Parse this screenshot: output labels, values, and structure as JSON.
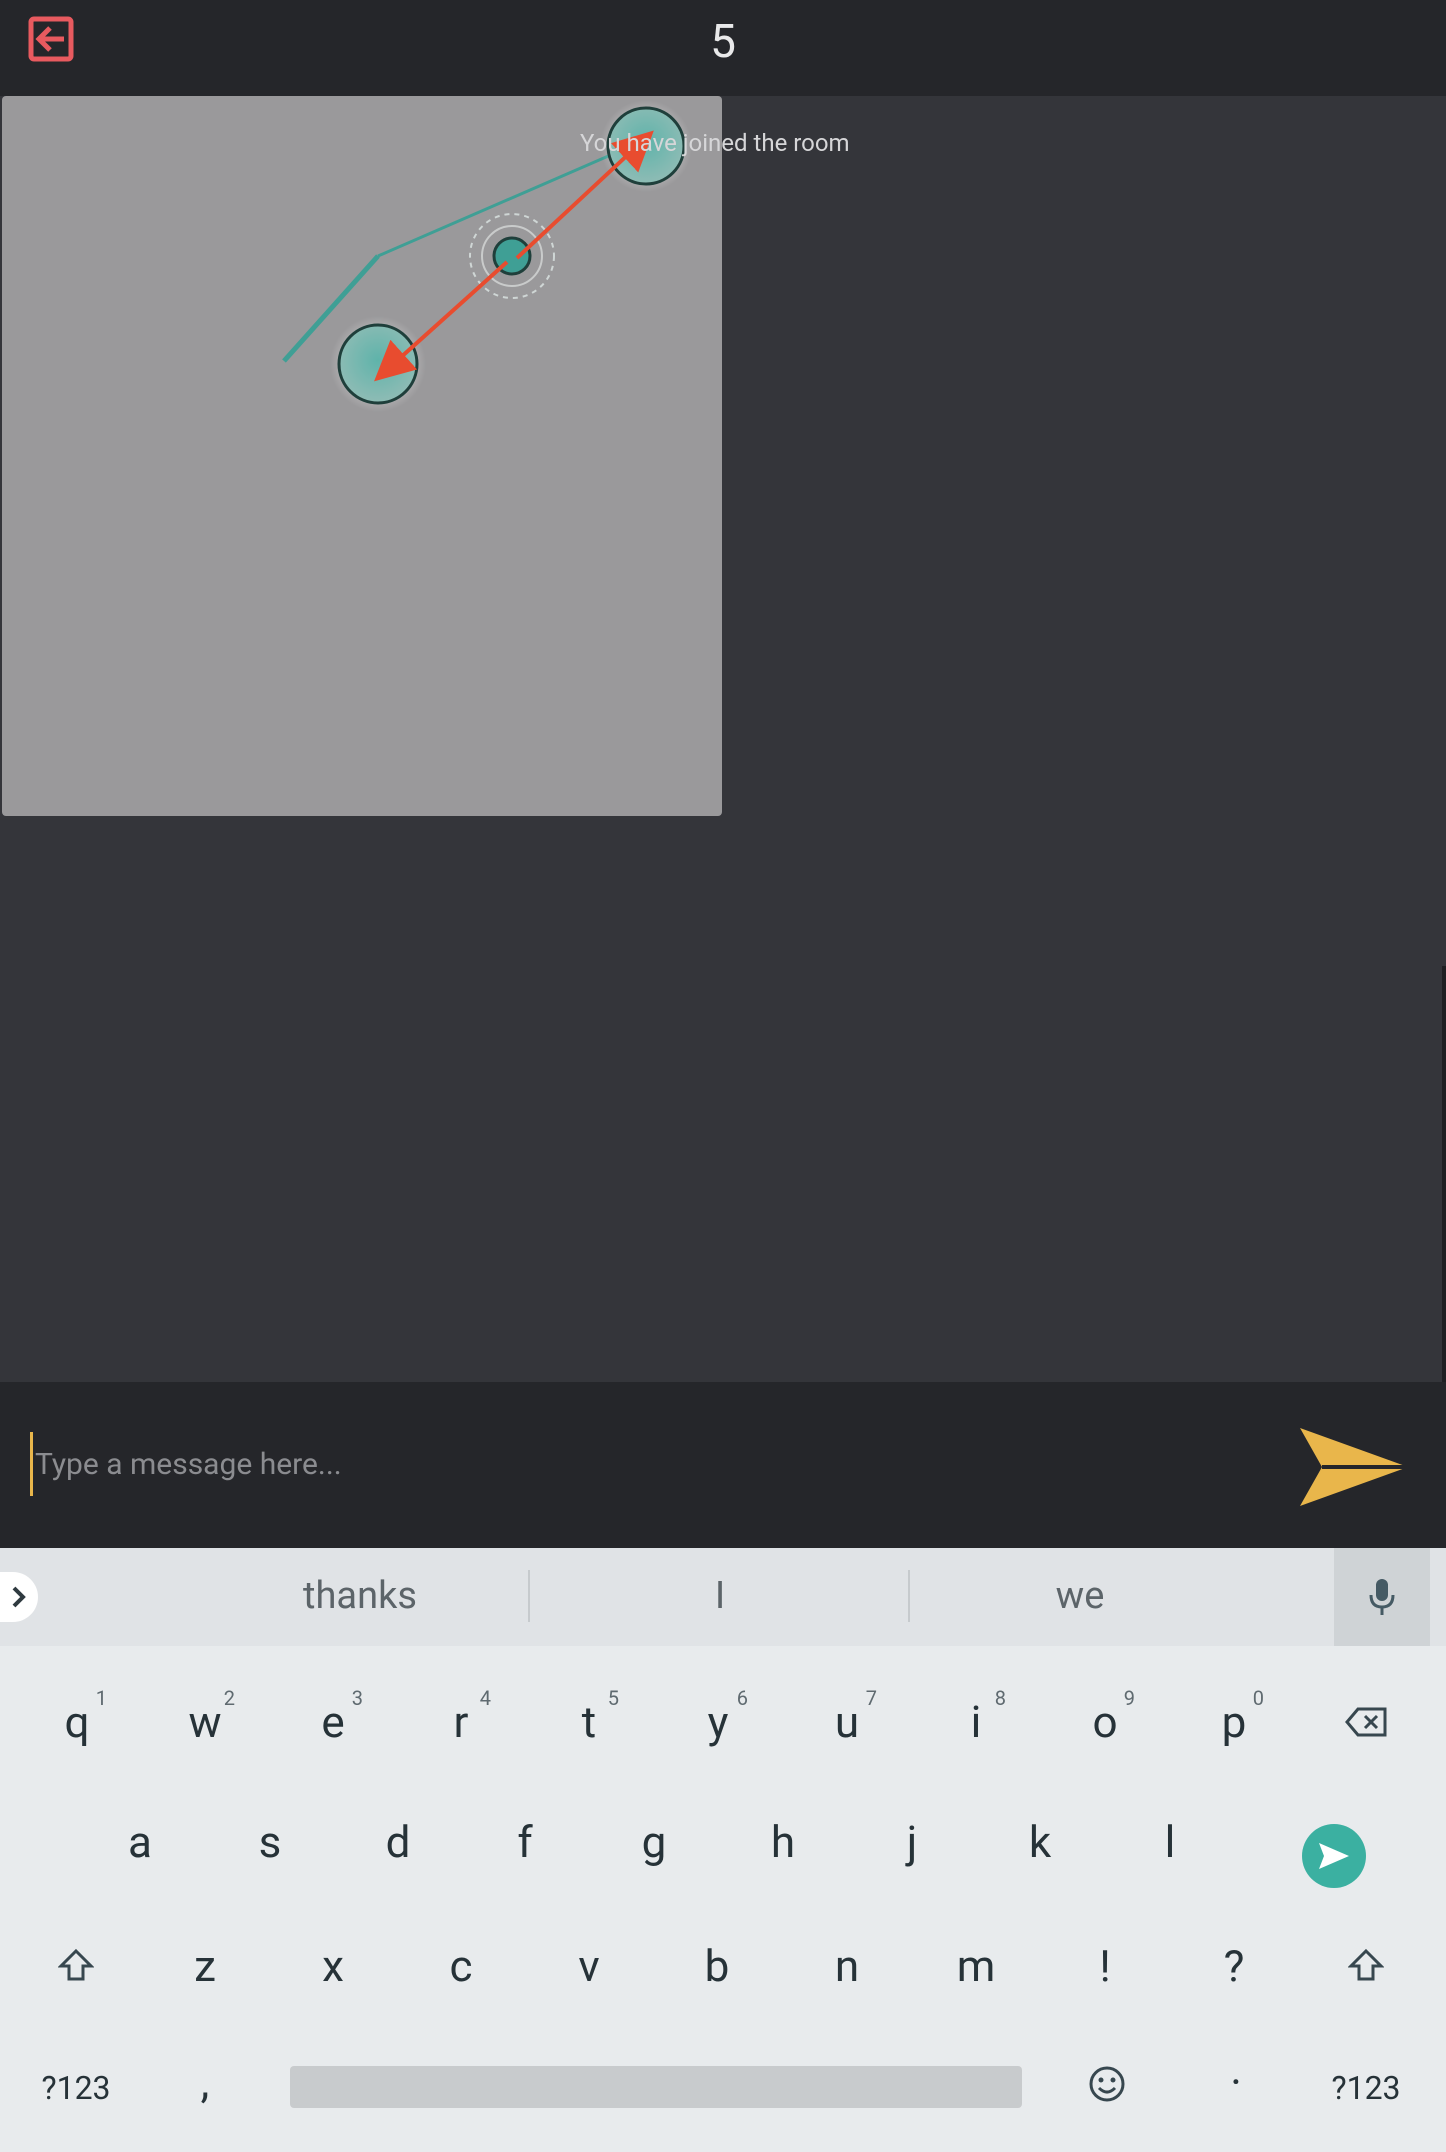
{
  "app": {
    "room_title": "5"
  },
  "chat": {
    "system_message": "You have joined the room"
  },
  "composer": {
    "placeholder": "Type a message here..."
  },
  "keyboard": {
    "suggestions": [
      "thanks",
      "I",
      "we"
    ],
    "row1": [
      {
        "label": "q",
        "hint": "1"
      },
      {
        "label": "w",
        "hint": "2"
      },
      {
        "label": "e",
        "hint": "3"
      },
      {
        "label": "r",
        "hint": "4"
      },
      {
        "label": "t",
        "hint": "5"
      },
      {
        "label": "y",
        "hint": "6"
      },
      {
        "label": "u",
        "hint": "7"
      },
      {
        "label": "i",
        "hint": "8"
      },
      {
        "label": "o",
        "hint": "9"
      },
      {
        "label": "p",
        "hint": "0"
      }
    ],
    "row2": [
      "a",
      "s",
      "d",
      "f",
      "g",
      "h",
      "j",
      "k",
      "l"
    ],
    "row3": [
      "z",
      "x",
      "c",
      "v",
      "b",
      "n",
      "m",
      "!",
      "?"
    ],
    "symbols_left": "?123",
    "comma": ",",
    "period": "·",
    "symbols_right": "?123"
  },
  "colors": {
    "exit_icon": "#e85a5f",
    "send_icon": "#e9b64b",
    "node_fill": "#3f9f95",
    "arrow": "#e84c2f",
    "enter_key": "#3bb0a1"
  }
}
